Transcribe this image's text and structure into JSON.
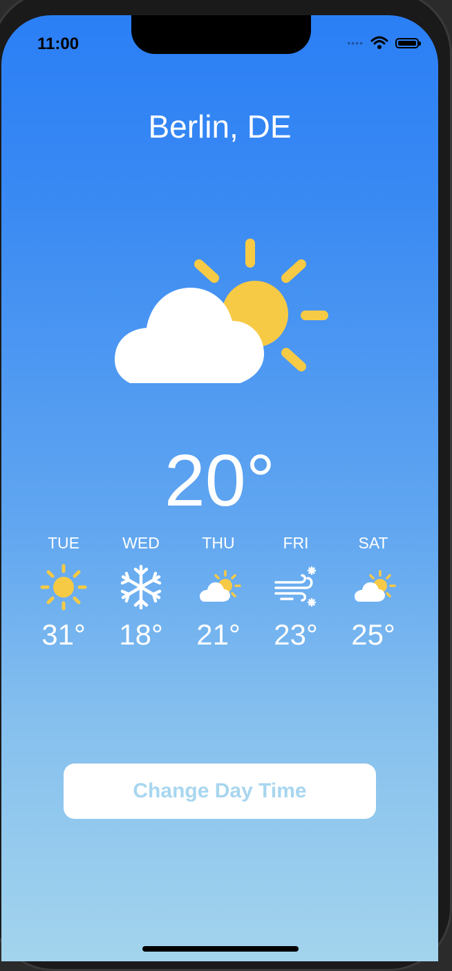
{
  "status_bar": {
    "time": "11:00",
    "signal_icon": "signal-dots-icon",
    "wifi_icon": "wifi-icon",
    "battery_icon": "battery-icon"
  },
  "location": {
    "city": "Berlin, DE"
  },
  "current": {
    "icon": "partly-sunny-icon",
    "temperature": "20°"
  },
  "forecast": [
    {
      "day": "TUE",
      "icon": "sun-icon",
      "temp": "31°"
    },
    {
      "day": "WED",
      "icon": "snowflake-icon",
      "temp": "18°"
    },
    {
      "day": "THU",
      "icon": "partly-sunny-icon",
      "temp": "21°"
    },
    {
      "day": "FRI",
      "icon": "wind-snow-icon",
      "temp": "23°"
    },
    {
      "day": "SAT",
      "icon": "partly-sunny-icon",
      "temp": "25°"
    }
  ],
  "actions": {
    "change_day_time_label": "Change Day Time"
  },
  "colors": {
    "gradient_top": "#2b7ff5",
    "gradient_bottom": "#a3d4ed",
    "sun_yellow": "#f7ca45",
    "button_text": "#a8d6ef"
  }
}
